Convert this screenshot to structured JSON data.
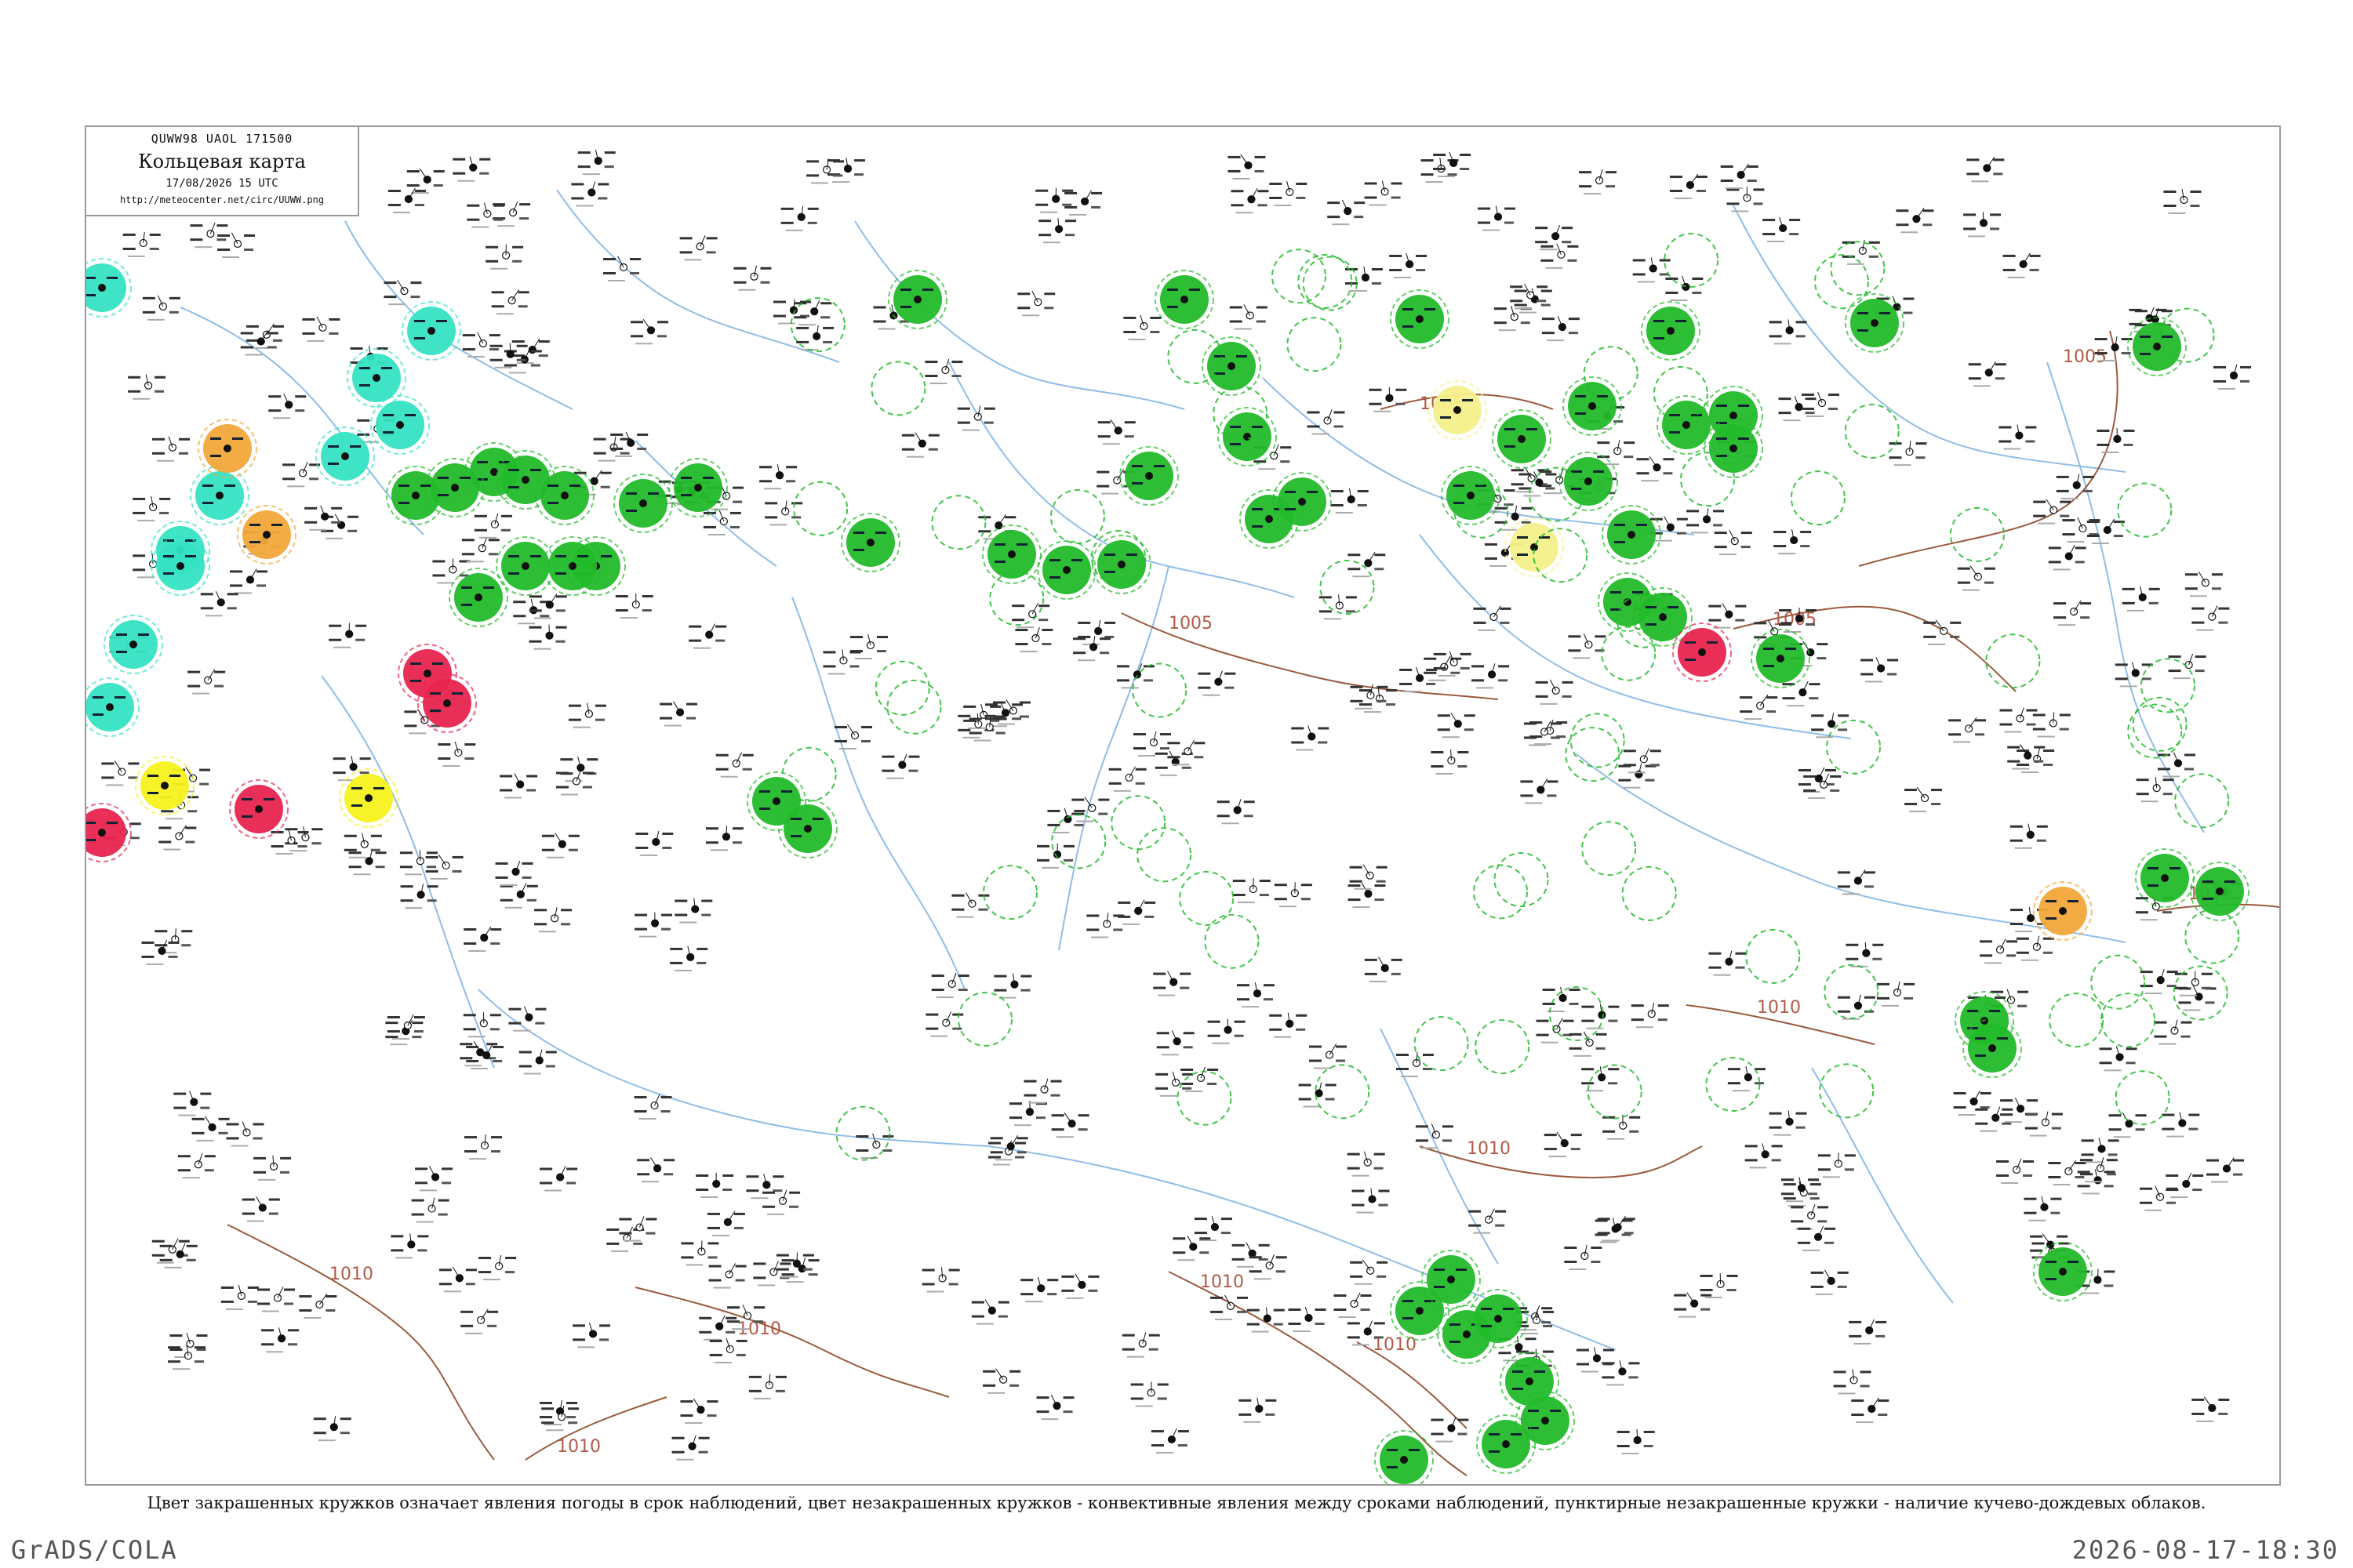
{
  "header": {
    "code": "QUWW98  UAOL  171500",
    "title": "Кольцевая карта",
    "date": "17/08/2026 15 UTC",
    "url": "http://meteocenter.net/circ/UUWW.png"
  },
  "caption": "Цвет закрашенных кружков означает явления погоды в срок наблюдений, цвет незакрашенных кружков - конвективные явления между сроками наблюдений, пунктирные незакрашенные кружки - наличие кучево-дождевых облаков.",
  "footer": {
    "left": "GrADS/COLA",
    "right": "2026-08-17-18:30"
  },
  "colors": {
    "green": "#22bb2a",
    "cyan": "#35e3c4",
    "orange": "#f2a73a",
    "yellow": "#f7f21e",
    "pale_yellow": "#f5f08a",
    "red": "#e8244f",
    "isobar": "#9a5a3d",
    "river": "#8fbde8"
  },
  "isobars": [
    {
      "label": "1005",
      "count": 1
    },
    {
      "label": "1005",
      "count": 1
    },
    {
      "label": "1005",
      "count": 1
    },
    {
      "label": "1005",
      "count": 1
    },
    {
      "label": "1010",
      "count": 1
    },
    {
      "label": "1010",
      "count": 1
    },
    {
      "label": "1010",
      "count": 1
    },
    {
      "label": "1010",
      "count": 1
    },
    {
      "label": "1010",
      "count": 1
    },
    {
      "label": "1010",
      "count": 1
    },
    {
      "label": "1010",
      "count": 1
    },
    {
      "label": "1010",
      "count": 1
    }
  ],
  "filled_markers": [
    {
      "color": "cyan",
      "count": 10
    },
    {
      "color": "green",
      "count": 52
    },
    {
      "color": "orange",
      "count": 3
    },
    {
      "color": "yellow",
      "count": 2
    },
    {
      "color": "pale_yellow",
      "count": 2
    },
    {
      "color": "red",
      "count": 5
    }
  ],
  "station_samples": [
    "156",
    "150",
    "122",
    "108",
    "207",
    "145",
    "142",
    "016",
    "147",
    "097",
    "180",
    "058",
    "263",
    "086",
    "72",
    "264",
    "090",
    "170",
    "209",
    "182"
  ]
}
